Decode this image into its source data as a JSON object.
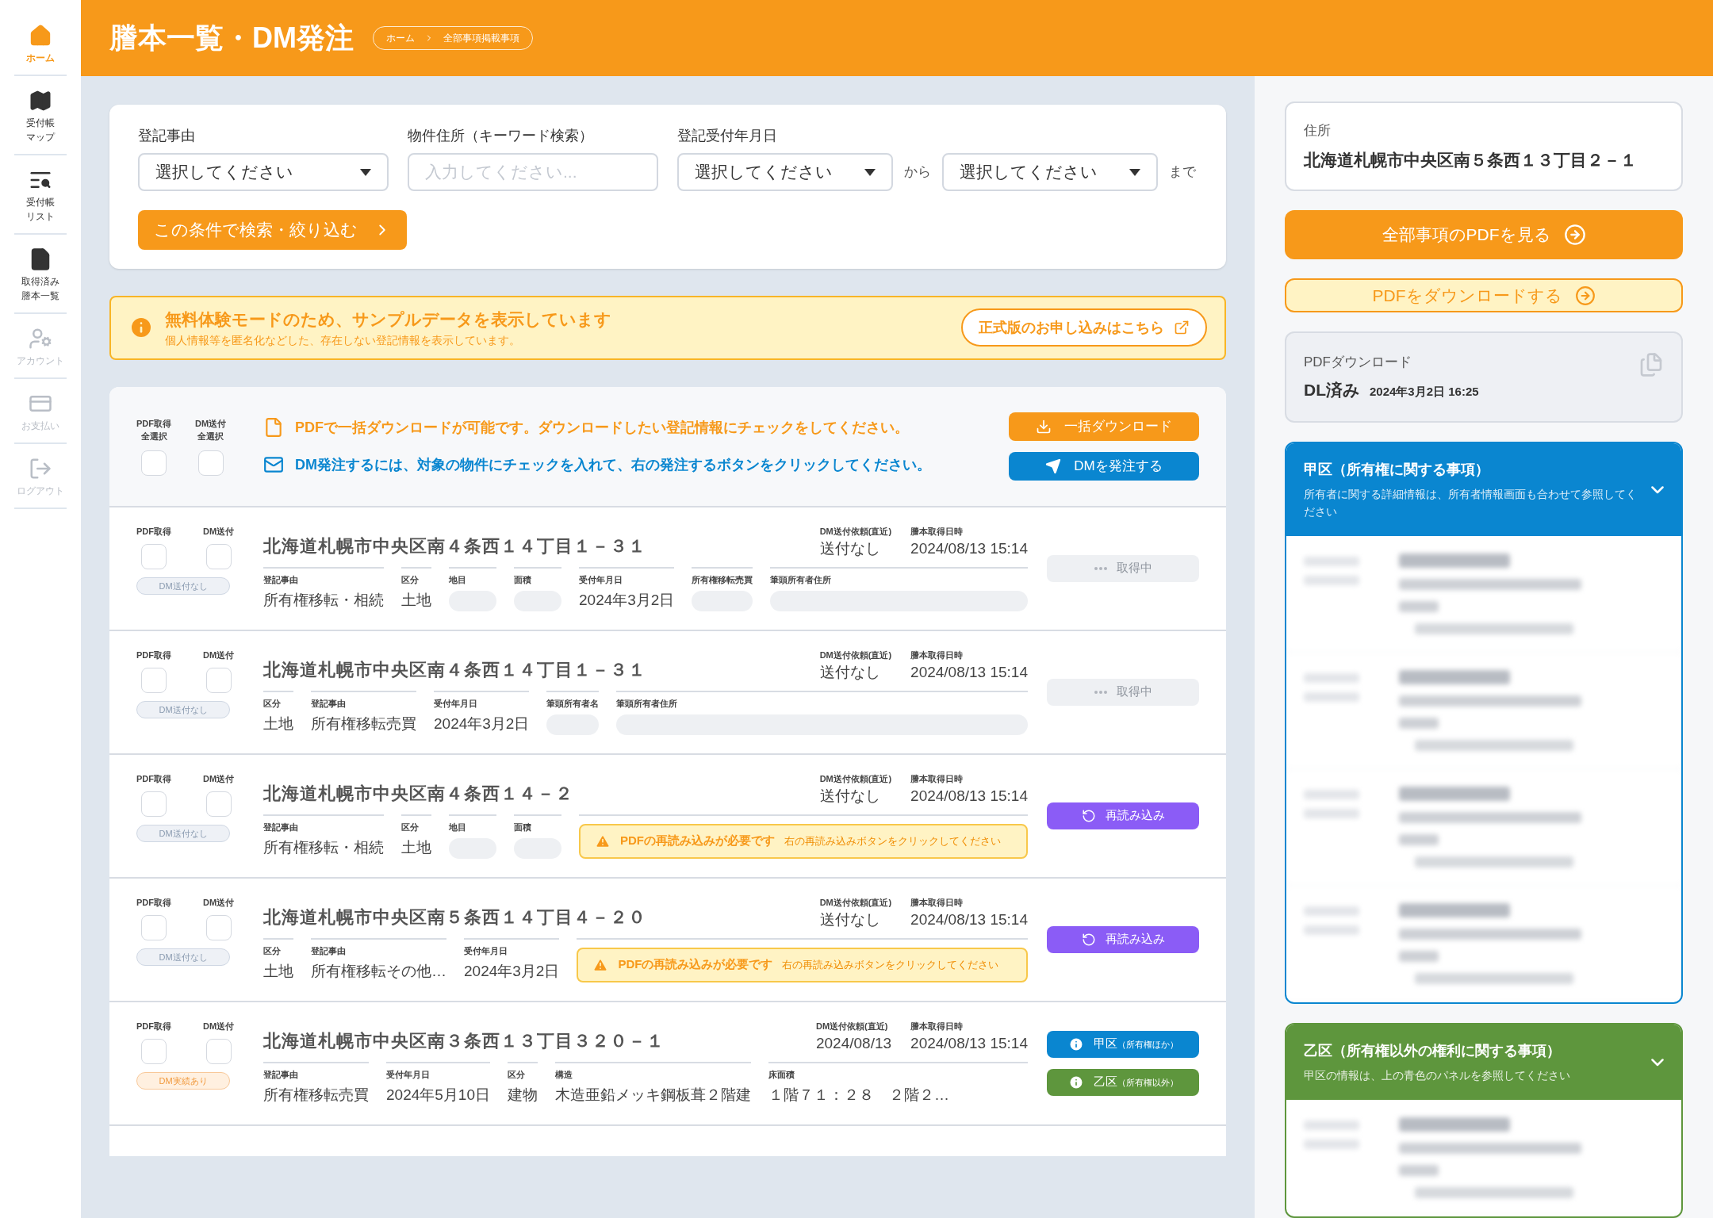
{
  "sidebar": {
    "items": [
      {
        "lines": [
          "ホーム"
        ],
        "selected": true,
        "disabled": false
      },
      {
        "lines": [
          "受付帳",
          "マップ"
        ],
        "selected": false,
        "disabled": false
      },
      {
        "lines": [
          "受付帳",
          "リスト"
        ],
        "selected": false,
        "disabled": false
      },
      {
        "lines": [
          "取得済み",
          "謄本一覧"
        ],
        "selected": false,
        "disabled": false
      },
      {
        "lines": [
          "アカウント"
        ],
        "selected": false,
        "disabled": true
      },
      {
        "lines": [
          "お支払い"
        ],
        "selected": false,
        "disabled": true
      },
      {
        "lines": [
          "ログアウト"
        ],
        "selected": false,
        "disabled": true
      }
    ]
  },
  "header": {
    "title": "謄本一覧・DM発注",
    "breadcrumb": [
      "ホーム",
      "全部事項掲載事項"
    ]
  },
  "filters": {
    "fields": [
      {
        "kind": "select",
        "label": "登記事由",
        "value": "選択してください"
      },
      {
        "kind": "input",
        "label": "物件住所（キーワード検索）",
        "placeholder": "入力してください..."
      },
      {
        "kind": "range",
        "label": "登記受付年月日",
        "from": "選択してください",
        "from_word": "から",
        "to": "選択してください",
        "to_word": "まで"
      }
    ],
    "search_button": "この条件で検索・絞り込む"
  },
  "notice": {
    "title": "無料体験モードのため、サンプルデータを表示しています",
    "text": "個人情報等を匿名化などした、存在しない登記情報を表示しています。",
    "button": "正式版のお申し込みはこちら"
  },
  "list": {
    "select_all": [
      {
        "lines": [
          "PDF取得",
          "全選択"
        ],
        "checked": false
      },
      {
        "lines": [
          "DM送付",
          "全選択"
        ],
        "checked": false
      }
    ],
    "messages": [
      {
        "kind": "pdf",
        "text": "PDFで一括ダウンロードが可能です。ダウンロードしたい登記情報にチェックをしてください。"
      },
      {
        "kind": "dm",
        "text": "DM発注するには、対象の物件にチェックを入れて、右の発注するボタンをクリックしてください。"
      }
    ],
    "buttons": [
      {
        "kind": "download",
        "label": "一括ダウンロード"
      },
      {
        "kind": "dm",
        "label": "DMを発注する"
      }
    ],
    "rows": [
      {
        "checks": [
          {
            "label": "PDF取得",
            "checked": false
          },
          {
            "label": "DM送付",
            "checked": false
          }
        ],
        "badge": {
          "kind": "none",
          "text": "DM送付なし"
        },
        "address": "北海道札幌市中央区南４条西１４丁目１－３１",
        "meta": [
          {
            "label": "DM送付依頼(直近)",
            "value": "送付なし"
          },
          {
            "label": "謄本取得日時",
            "value": "2024/08/13 15:14"
          }
        ],
        "fields": [
          {
            "label": "登記事由",
            "value": "所有権移転・相続"
          },
          {
            "label": "区分",
            "value": "土地"
          },
          {
            "label": "地目",
            "masked": true
          },
          {
            "label": "面積",
            "masked": true
          },
          {
            "label": "受付年月日",
            "value": "2024年3月2日"
          },
          {
            "label": "所有権移転売買",
            "masked": true
          },
          {
            "label": "筆頭所有者住所",
            "masked": true
          }
        ],
        "actions": [
          {
            "kind": "pending",
            "label": "取得中"
          }
        ]
      },
      {
        "checks": [
          {
            "label": "PDF取得",
            "checked": false
          },
          {
            "label": "DM送付",
            "checked": false
          }
        ],
        "badge": {
          "kind": "none",
          "text": "DM送付なし"
        },
        "address": "北海道札幌市中央区南４条西１４丁目１－３１",
        "meta": [
          {
            "label": "DM送付依頼(直近)",
            "value": "送付なし"
          },
          {
            "label": "謄本取得日時",
            "value": "2024/08/13 15:14"
          }
        ],
        "fields": [
          {
            "label": "区分",
            "value": "土地"
          },
          {
            "label": "登記事由",
            "value": "所有権移転売買"
          },
          {
            "label": "受付年月日",
            "value": "2024年3月2日"
          },
          {
            "label": "筆頭所有者名",
            "masked": true
          },
          {
            "label": "筆頭所有者住所",
            "masked": true
          }
        ],
        "actions": [
          {
            "kind": "pending",
            "label": "取得中"
          }
        ]
      },
      {
        "checks": [
          {
            "label": "PDF取得",
            "checked": false
          },
          {
            "label": "DM送付",
            "checked": false
          }
        ],
        "badge": {
          "kind": "none",
          "text": "DM送付なし"
        },
        "address": "北海道札幌市中央区南４条西１４－２",
        "meta": [
          {
            "label": "DM送付依頼(直近)",
            "value": "送付なし"
          },
          {
            "label": "謄本取得日時",
            "value": "2024/08/13 15:14"
          }
        ],
        "fields": [
          {
            "label": "登記事由",
            "value": "所有権移転・相続"
          },
          {
            "label": "区分",
            "value": "土地"
          },
          {
            "label": "地目",
            "masked": true
          },
          {
            "label": "面積",
            "masked": true
          }
        ],
        "warning": {
          "title": "PDFの再読み込みが必要です",
          "hint": "右の再読み込みボタンをクリックしてください"
        },
        "actions": [
          {
            "kind": "reload",
            "label": "再読み込み"
          }
        ]
      },
      {
        "checks": [
          {
            "label": "PDF取得",
            "checked": false
          },
          {
            "label": "DM送付",
            "checked": false
          }
        ],
        "badge": {
          "kind": "none",
          "text": "DM送付なし"
        },
        "address": "北海道札幌市中央区南５条西１４丁目４－２０",
        "meta": [
          {
            "label": "DM送付依頼(直近)",
            "value": "送付なし"
          },
          {
            "label": "謄本取得日時",
            "value": "2024/08/13 15:14"
          }
        ],
        "fields": [
          {
            "label": "区分",
            "value": "土地"
          },
          {
            "label": "登記事由",
            "value": "所有権移転その他…"
          },
          {
            "label": "受付年月日",
            "value": "2024年3月2日"
          }
        ],
        "warning": {
          "title": "PDFの再読み込みが必要です",
          "hint": "右の再読み込みボタンをクリックしてください"
        },
        "actions": [
          {
            "kind": "reload",
            "label": "再読み込み"
          }
        ]
      },
      {
        "checks": [
          {
            "label": "PDF取得",
            "checked": false
          },
          {
            "label": "DM送付",
            "checked": false
          }
        ],
        "badge": {
          "kind": "sent",
          "text": "DM実績あり"
        },
        "address": "北海道札幌市中央区南３条西１３丁目３２０－１",
        "meta": [
          {
            "label": "DM送付依頼(直近)",
            "value": "2024/08/13"
          },
          {
            "label": "謄本取得日時",
            "value": "2024/08/13 15:14"
          }
        ],
        "fields": [
          {
            "label": "登記事由",
            "value": "所有権移転売買"
          },
          {
            "label": "受付年月日",
            "value": "2024年5月10日"
          },
          {
            "label": "区分",
            "value": "建物"
          },
          {
            "label": "構造",
            "value": "木造亜鉛メッキ鋼板葺２階建"
          },
          {
            "label": "床面積",
            "value": "１階７１：２８　２階２…"
          }
        ],
        "actions": [
          {
            "kind": "kou",
            "label": "甲区",
            "sub": "（所有権ほか）"
          },
          {
            "kind": "otsu",
            "label": "乙区",
            "sub": "（所有権以外）"
          }
        ]
      }
    ]
  },
  "detail": {
    "address_label": "住所",
    "address": "北海道札幌市中央区南５条西１３丁目２－１",
    "view_button": "全部事項のPDFを見る",
    "download_button": "PDFをダウンロードする",
    "download_status": {
      "label": "PDFダウンロード",
      "status": "DL済み",
      "date": "2024年3月2日 16:25"
    },
    "sections": [
      {
        "kind": "kou",
        "title": "甲区（所有権に関する事項）",
        "text": "所有者に関する詳細情報は、所有者情報画面も合わせて参照してください",
        "entries": [
          {
            "kind": "blurred"
          },
          {
            "kind": "blurred"
          },
          {
            "kind": "blurred"
          },
          {
            "kind": "blurred"
          }
        ]
      },
      {
        "kind": "otsu",
        "title": "乙区（所有権以外の権利に関する事項）",
        "text": "甲区の情報は、上の青色のパネルを参照してください",
        "entries": [
          {
            "kind": "blurred"
          }
        ]
      }
    ]
  }
}
